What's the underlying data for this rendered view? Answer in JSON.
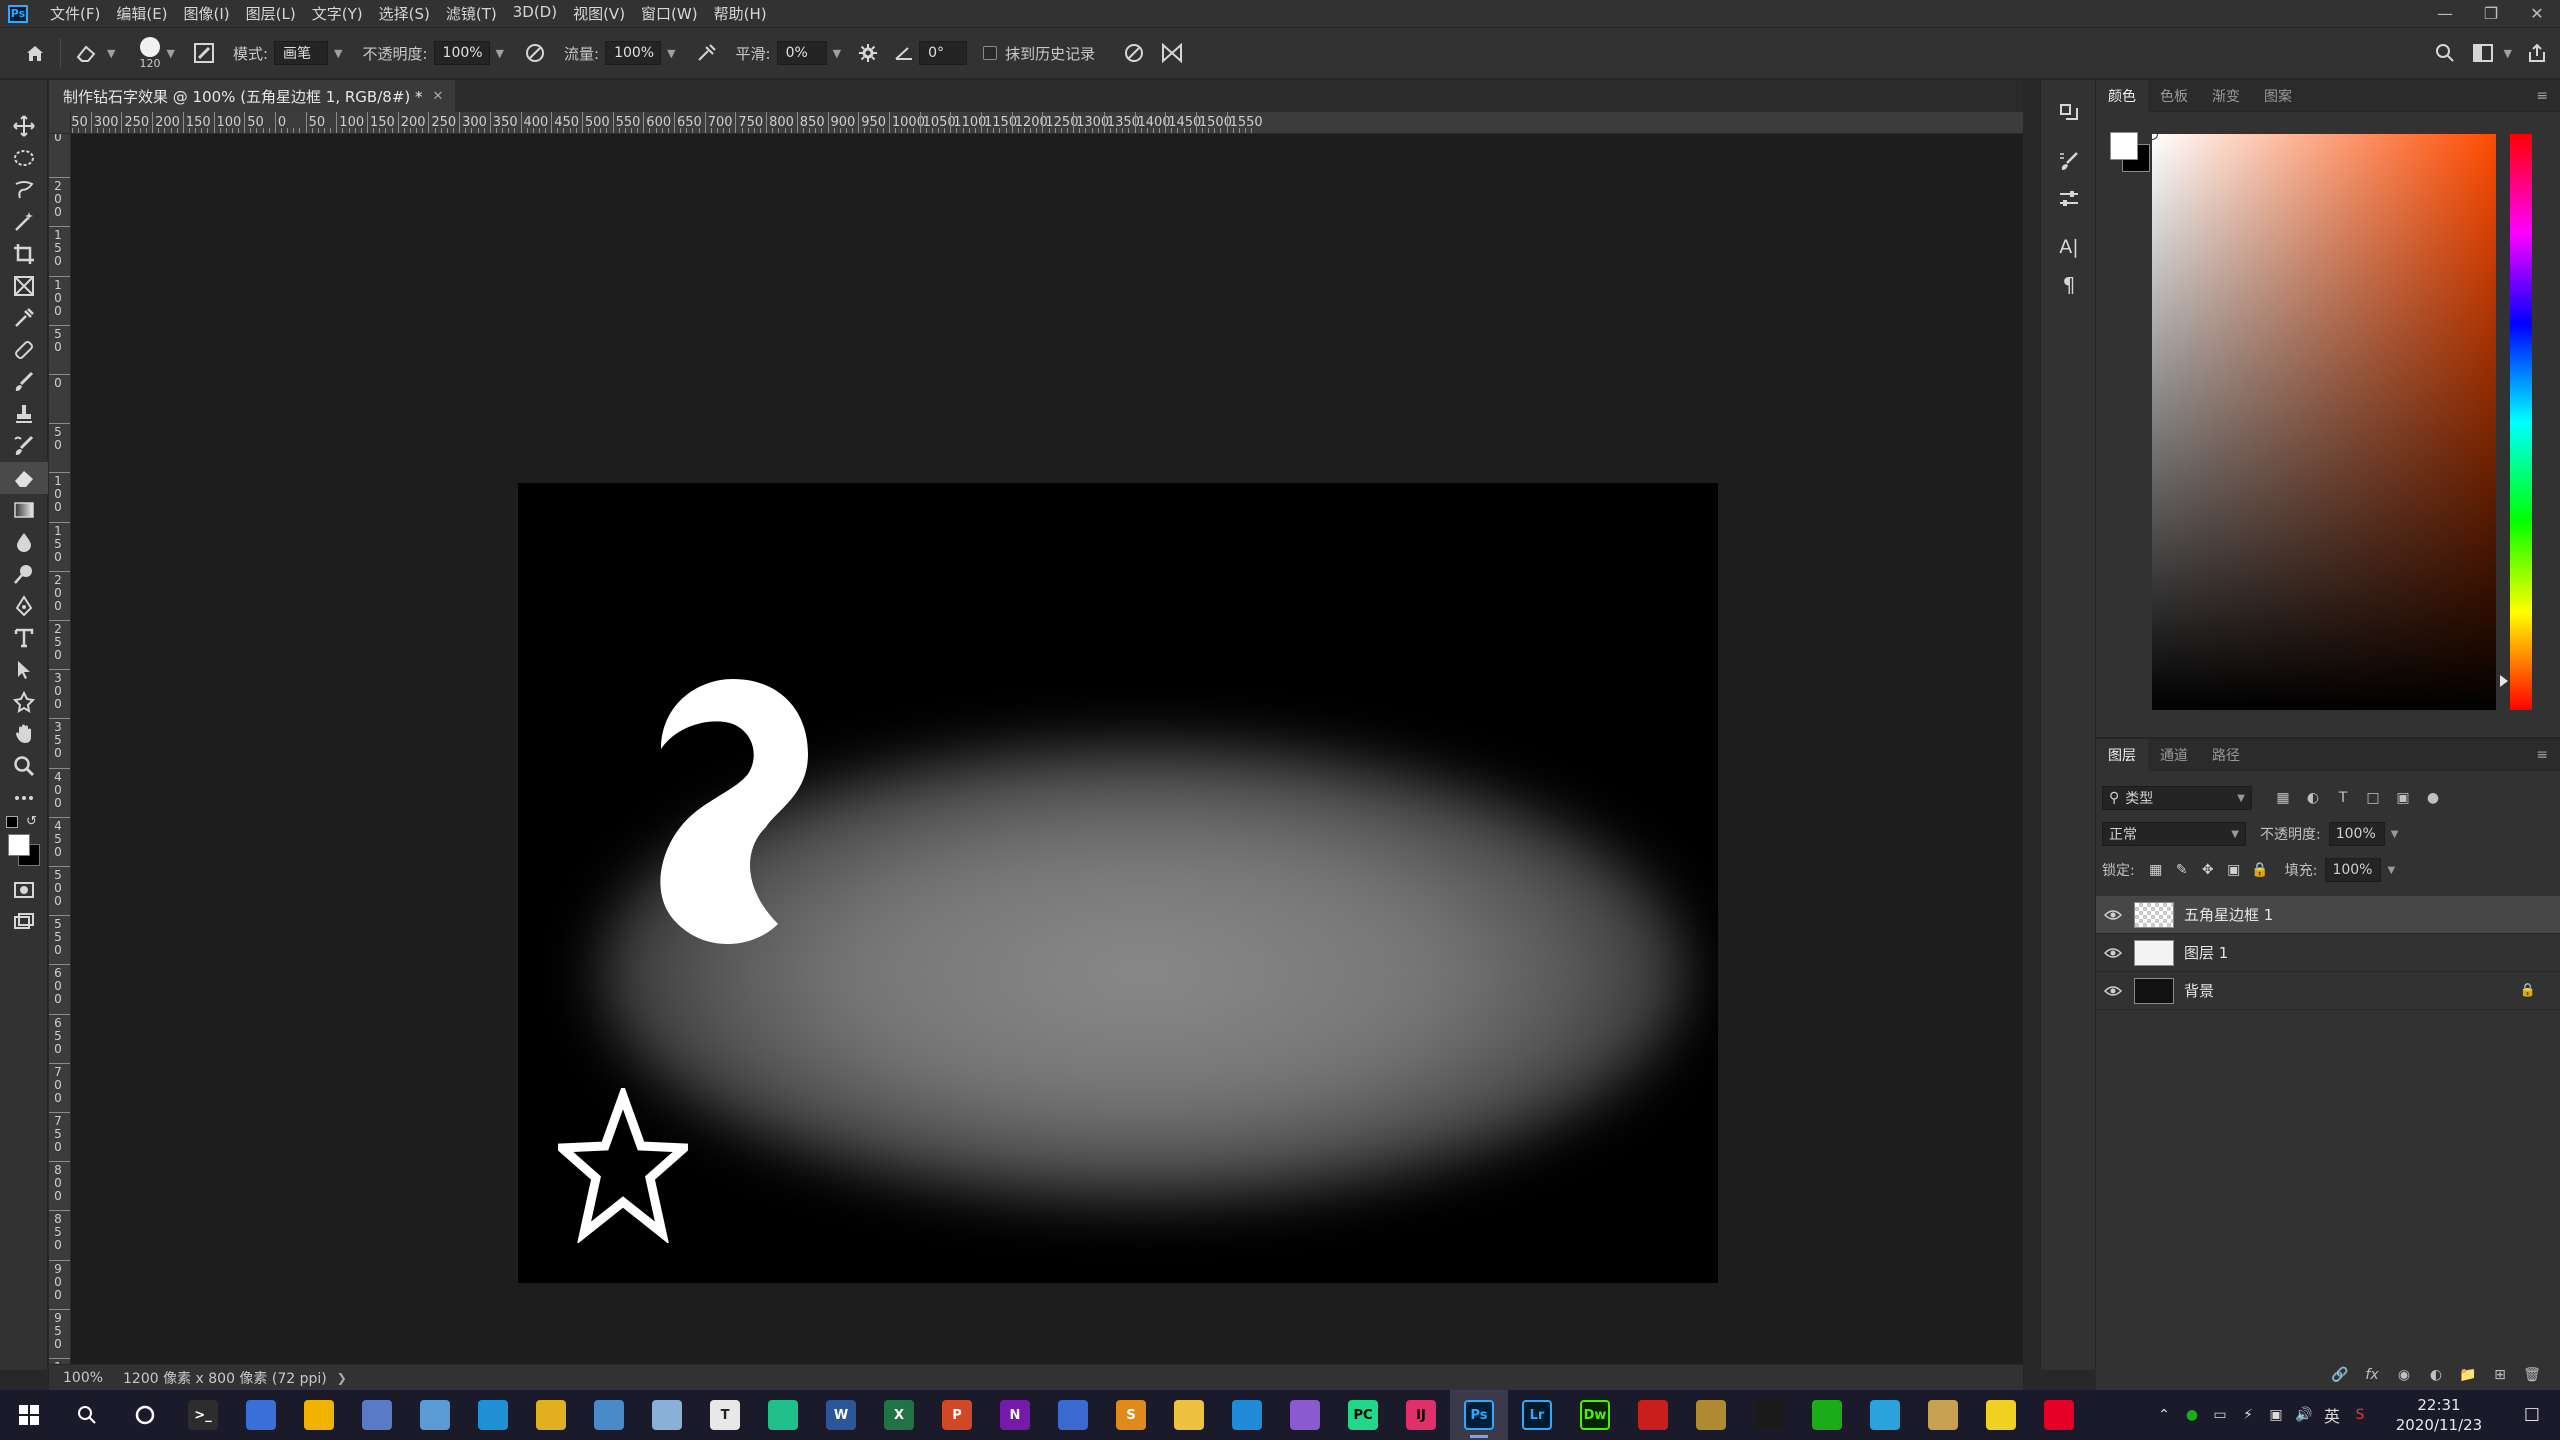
{
  "app": {
    "logo": "Ps",
    "menu": [
      "文件(F)",
      "编辑(E)",
      "图像(I)",
      "图层(L)",
      "文字(Y)",
      "选择(S)",
      "滤镜(T)",
      "3D(D)",
      "视图(V)",
      "窗口(W)",
      "帮助(H)"
    ],
    "window_controls": [
      "minimize-icon",
      "restore-icon",
      "close-icon"
    ]
  },
  "options": {
    "brush_size": "120",
    "mode_label": "模式:",
    "mode_value": "画笔",
    "opacity_label": "不透明度:",
    "opacity_value": "100%",
    "flow_label": "流量:",
    "flow_value": "100%",
    "smoothing_label": "平滑:",
    "smoothing_value": "0%",
    "angle_value": "0°",
    "erase_history_label": "抹到历史记录"
  },
  "document": {
    "tab_title": "制作钻石字效果 @ 100% (五角星边框 1, RGB/8#) *",
    "zoom": "100%",
    "info": "1200 像素 x 800 像素 (72 ppi)",
    "ruler_h_labels": [
      "350",
      "300",
      "250",
      "200",
      "150",
      "100",
      "50",
      "0",
      "50",
      "100",
      "150",
      "200",
      "250",
      "300",
      "350",
      "400",
      "450",
      "500",
      "550",
      "600",
      "650",
      "700",
      "750",
      "800",
      "850",
      "900",
      "950",
      "1000",
      "1050",
      "1100",
      "1150",
      "1200",
      "1250",
      "1300",
      "1350",
      "1400",
      "1450",
      "1500",
      "1550"
    ],
    "ruler_v_labels": [
      "0",
      "2\n0\n0",
      "1\n5\n0",
      "1\n0\n0",
      "5\n0",
      "0",
      "5\n0",
      "1\n0\n0",
      "1\n5\n0",
      "2\n0\n0",
      "2\n5\n0",
      "3\n0\n0",
      "3\n5\n0",
      "4\n0\n0",
      "4\n5\n0",
      "5\n0\n0",
      "5\n5\n0",
      "6\n0\n0",
      "6\n5\n0",
      "7\n0\n0",
      "7\n5\n0",
      "8\n0\n0",
      "8\n5\n0",
      "9\n0\n0",
      "9\n5\n0",
      "1"
    ]
  },
  "colors": {
    "foreground": "#ffffff",
    "background": "#000000",
    "picker_hue": "#ff4a00"
  },
  "color_panel": {
    "tabs": [
      "颜色",
      "色板",
      "渐变",
      "图案"
    ]
  },
  "layers_panel": {
    "tabs": [
      "图层",
      "通道",
      "路径"
    ],
    "filter_label": "类型",
    "blend_mode": "正常",
    "opacity_label": "不透明度:",
    "opacity_value": "100%",
    "lock_label": "锁定:",
    "fill_label": "填充:",
    "fill_value": "100%",
    "layers": [
      {
        "name": "五角星边框 1",
        "selected": true,
        "thumb": "checker",
        "locked": false
      },
      {
        "name": "图层 1",
        "selected": false,
        "thumb": "white",
        "locked": false
      },
      {
        "name": "背景",
        "selected": false,
        "thumb": "black",
        "locked": true
      }
    ]
  },
  "taskbar": {
    "time": "22:31",
    "date": "2020/11/23",
    "ime": "英",
    "apps": [
      {
        "name": "search-icon",
        "glyph": "",
        "color": "transparent"
      },
      {
        "name": "cortana-icon",
        "glyph": "",
        "color": "transparent"
      },
      {
        "name": "terminal-icon",
        "glyph": ">_",
        "color": "#2d2d2d"
      },
      {
        "name": "paint3d-icon",
        "glyph": "",
        "color": "#3a6fd8"
      },
      {
        "name": "file-explorer-icon",
        "glyph": "",
        "color": "#f0b400"
      },
      {
        "name": "calculator-icon",
        "glyph": "",
        "color": "#5a7ac8"
      },
      {
        "name": "pinwheel-icon",
        "glyph": "",
        "color": "#5c9ad6"
      },
      {
        "name": "edge-icon",
        "glyph": "",
        "color": "#1f8fd6"
      },
      {
        "name": "chrome-icon",
        "glyph": "",
        "color": "#e0b020"
      },
      {
        "name": "notes-icon",
        "glyph": "",
        "color": "#4a8ac8"
      },
      {
        "name": "paint-icon",
        "glyph": "",
        "color": "#8ab0d8"
      },
      {
        "name": "typora-icon",
        "glyph": "T",
        "color": "#e8e8e8"
      },
      {
        "name": "maplestory-icon",
        "glyph": "",
        "color": "#1fc08a"
      },
      {
        "name": "word-icon",
        "glyph": "W",
        "color": "#2b579a"
      },
      {
        "name": "excel-icon",
        "glyph": "X",
        "color": "#217346"
      },
      {
        "name": "powerpoint-icon",
        "glyph": "P",
        "color": "#d24726"
      },
      {
        "name": "onenote-icon",
        "glyph": "N",
        "color": "#7719aa"
      },
      {
        "name": "devcpp-icon",
        "glyph": "",
        "color": "#3a6ad0"
      },
      {
        "name": "sublime-icon",
        "glyph": "S",
        "color": "#e08a1c"
      },
      {
        "name": "notepad-icon",
        "glyph": "",
        "color": "#f0c040"
      },
      {
        "name": "vscode-icon",
        "glyph": "",
        "color": "#1f8ad8"
      },
      {
        "name": "visual-studio-icon",
        "glyph": "",
        "color": "#8a5ad0"
      },
      {
        "name": "pycharm-icon",
        "glyph": "PC",
        "color": "#21d789"
      },
      {
        "name": "intellij-icon",
        "glyph": "IJ",
        "color": "#e0306a"
      },
      {
        "name": "photoshop-icon",
        "glyph": "Ps",
        "color": "#001e36"
      },
      {
        "name": "lightroom-icon",
        "glyph": "Lr",
        "color": "#001a2a"
      },
      {
        "name": "dreamweaver-icon",
        "glyph": "Dw",
        "color": "#072401"
      },
      {
        "name": "acrobat-icon",
        "glyph": "",
        "color": "#c81e1e"
      },
      {
        "name": "game-icon",
        "glyph": "",
        "color": "#b08a30"
      },
      {
        "name": "qq-icon",
        "glyph": "",
        "color": "#1a1a1a"
      },
      {
        "name": "wechat-icon",
        "glyph": "",
        "color": "#1aad19"
      },
      {
        "name": "telegram-icon",
        "glyph": "",
        "color": "#2aa2dc"
      },
      {
        "name": "store-icon",
        "glyph": "",
        "color": "#c8a050"
      },
      {
        "name": "pet-icon",
        "glyph": "",
        "color": "#f0d020"
      },
      {
        "name": "netease-music-icon",
        "glyph": "",
        "color": "#e60026"
      }
    ]
  }
}
